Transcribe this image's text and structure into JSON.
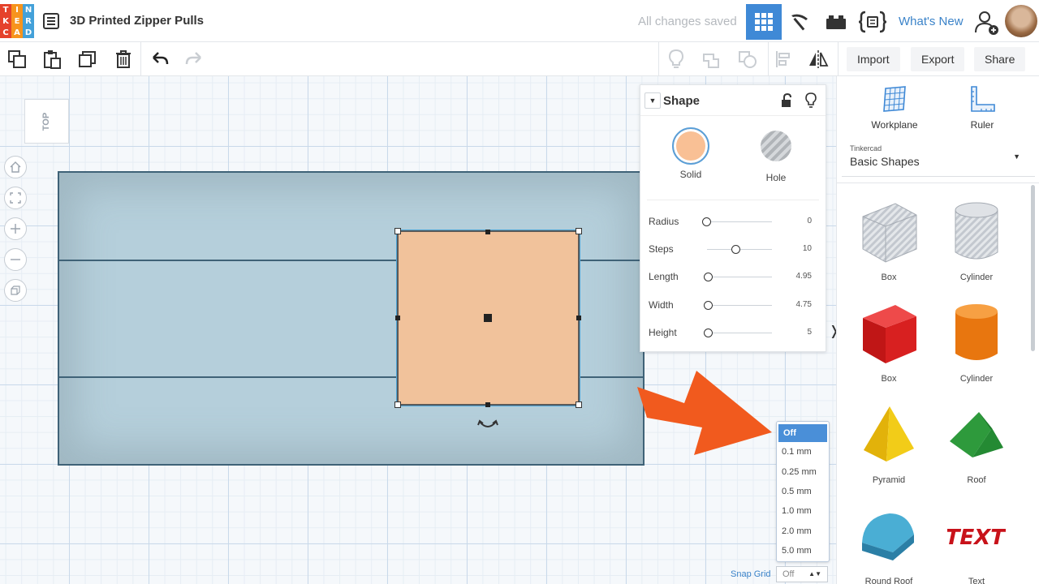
{
  "header": {
    "logo_letters": [
      "T",
      "I",
      "N",
      "K",
      "E",
      "R",
      "C",
      "A",
      "D"
    ],
    "logo_colors": [
      "#e5422b",
      "#f7941d",
      "#44a1d9",
      "#e5422b",
      "#f7941d",
      "#44a1d9",
      "#e5422b",
      "#f7941d",
      "#44a1d9"
    ],
    "title": "3D Printed Zipper Pulls",
    "save_status": "All changes saved",
    "whats_new": "What's New",
    "view_icons": [
      "3d-design-grid-icon",
      "minecraft-pickaxe-icon",
      "lego-brick-icon",
      "codeblocks-icon"
    ],
    "accent_color": "#3f89d6"
  },
  "toolbar": {
    "left_icons": [
      "copy-icon",
      "paste-icon",
      "duplicate-icon",
      "delete-icon",
      "undo-icon",
      "redo-icon"
    ],
    "right_icons": [
      "light-bulb-icon",
      "group-icon",
      "ungroup-icon",
      "align-icon",
      "mirror-icon"
    ],
    "import_label": "Import",
    "export_label": "Export",
    "share_label": "Share"
  },
  "workspace": {
    "viewcube_label": "TOP",
    "nav_buttons": [
      "home-view-icon",
      "fit-view-icon",
      "zoom-in-icon",
      "zoom-out-icon",
      "ortho-view-icon"
    ],
    "selected_shape_color": "#f1c29b"
  },
  "inspector": {
    "title": "Shape",
    "solid_label": "Solid",
    "hole_label": "Hole",
    "solid_color": "#f9c095",
    "params": [
      {
        "label": "Radius",
        "value": "0",
        "slider": 0.0
      },
      {
        "label": "Steps",
        "value": "10",
        "slider": 0.45
      },
      {
        "label": "Length",
        "value": "4.95",
        "slider": 0.02
      },
      {
        "label": "Width",
        "value": "4.75",
        "slider": 0.02
      },
      {
        "label": "Height",
        "value": "5",
        "slider": 0.02
      }
    ]
  },
  "snap_grid": {
    "label": "Snap Grid",
    "selected": "Off",
    "options": [
      "Off",
      "0.1 mm",
      "0.25 mm",
      "0.5 mm",
      "1.0 mm",
      "2.0 mm",
      "5.0 mm"
    ]
  },
  "right_panel": {
    "workplane_label": "Workplane",
    "ruler_label": "Ruler",
    "library_source": "Tinkercad",
    "library_name": "Basic Shapes",
    "shapes": [
      {
        "name": "Box",
        "kind": "box-hole"
      },
      {
        "name": "Cylinder",
        "kind": "cylinder-hole"
      },
      {
        "name": "Box",
        "kind": "box-red"
      },
      {
        "name": "Cylinder",
        "kind": "cylinder-orange"
      },
      {
        "name": "Pyramid",
        "kind": "pyramid"
      },
      {
        "name": "Roof",
        "kind": "roof"
      },
      {
        "name": "Round Roof",
        "kind": "round-roof"
      },
      {
        "name": "Text",
        "kind": "text"
      }
    ]
  },
  "annotation": {
    "arrow_color": "#f15a1e"
  }
}
